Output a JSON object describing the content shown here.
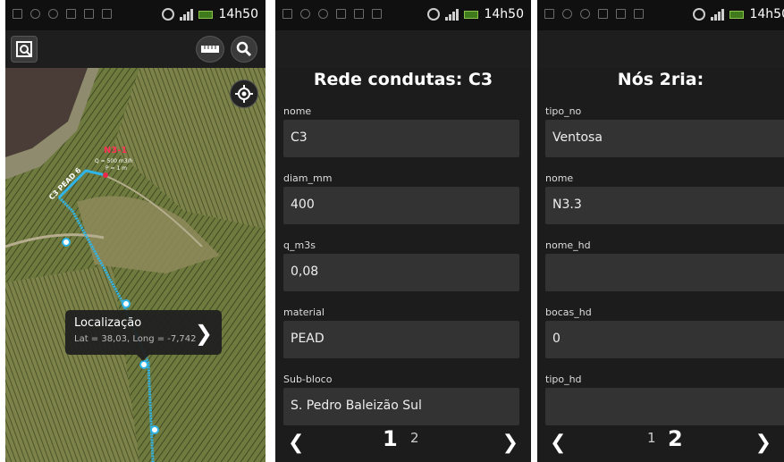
{
  "status": {
    "time": "14h50"
  },
  "map_screen": {
    "callout": {
      "title": "Localização",
      "subtitle": "Lat = 38,03, Long = -7,742"
    },
    "map_labels": {
      "node": "N3-1",
      "pipe": "C3 PEAD 6",
      "node_info1": "Q = 500 m3/h",
      "node_info2": "P = 1 m"
    }
  },
  "pipe_form": {
    "title": "Rede condutas: C3",
    "fields": [
      {
        "label": "nome",
        "value": "C3"
      },
      {
        "label": "diam_mm",
        "value": "400"
      },
      {
        "label": "q_m3s",
        "value": "0,08"
      },
      {
        "label": "material",
        "value": "PEAD"
      },
      {
        "label": "Sub-bloco",
        "value": "S. Pedro Baleizão Sul"
      }
    ],
    "pages": [
      "1",
      "2"
    ],
    "current_page": 1
  },
  "node_form": {
    "title": "Nós 2ria:",
    "fields": [
      {
        "label": "tipo_no",
        "value": "Ventosa"
      },
      {
        "label": "nome",
        "value": "N3.3"
      },
      {
        "label": "nome_hd",
        "value": ""
      },
      {
        "label": "bocas_hd",
        "value": "0"
      },
      {
        "label": "tipo_hd",
        "value": ""
      }
    ],
    "pages": [
      "1",
      "2"
    ],
    "current_page": 2
  },
  "icons": [
    "notification-icon",
    "usb-icon",
    "photo-icon",
    "facebook-icon",
    "alarm-icon",
    "signal-icon",
    "battery-icon",
    "zoom-layer-icon",
    "ruler-icon",
    "search-icon",
    "locate-icon",
    "chevron-right-icon",
    "chevron-left-icon"
  ]
}
